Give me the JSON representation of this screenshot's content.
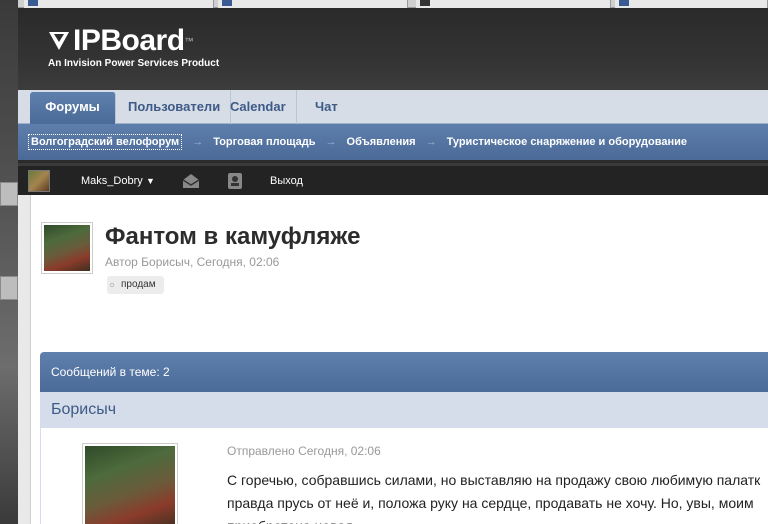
{
  "header": {
    "logo_text": "IPBoard",
    "logo_tm": "™",
    "logo_subtitle": "An Invision Power Services Product"
  },
  "primary_nav": {
    "tabs": [
      {
        "label": "Форумы",
        "active": true
      },
      {
        "label": "Пользователи",
        "active": false
      },
      {
        "label": "Calendar",
        "active": false
      },
      {
        "label": "Чат",
        "active": false
      }
    ]
  },
  "breadcrumb": {
    "items": [
      "Волгоградский велофорум",
      "Торговая площадь",
      "Объявления",
      "Туристическое снаряжение и оборудование"
    ],
    "separator": "→"
  },
  "userbar": {
    "username": "Maks_Dobry",
    "caret": "▼",
    "logout": "Выход"
  },
  "topic": {
    "title": "Фантом в камуфляже",
    "meta": "Автор Борисыч, Сегодня, 02:06",
    "tag": "продам"
  },
  "posts": {
    "count_label": "Сообщений в теме: 2",
    "author": "Борисыч",
    "date": "Отправлено Сегодня, 02:06",
    "lines": [
      "С горечью, собравшись силами, но выставляю на продажу свою любимую палатк",
      "правда прусь от неё и, положа руку на сердце, продавать не хочу. Но, увы, моим",
      "приобретена новая"
    ]
  },
  "colors": {
    "accent_blue": "#4a6a98",
    "nav_bg": "#d6dde7",
    "header_dark": "#2a2a2a"
  }
}
